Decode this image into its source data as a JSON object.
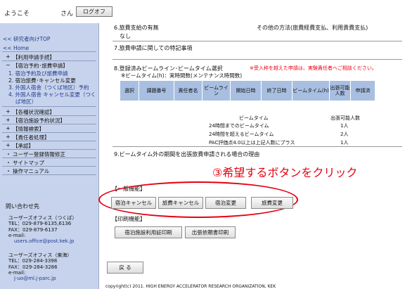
{
  "header": {
    "welcome": "ようこそ",
    "san": "さん",
    "logoff": "ログオフ"
  },
  "sidebar": {
    "top_link": "<< 研究者向けTOP",
    "home_link": "<< Home",
    "items": [
      {
        "mark": "+",
        "label": "【利用申請手続】"
      },
      {
        "mark": "−",
        "label": "【宿泊予約･旅費申請】"
      },
      {
        "mark": "+",
        "label": "【各種状況確認】"
      },
      {
        "mark": "+",
        "label": "【宿泊施設予約状況】"
      },
      {
        "mark": "+",
        "label": "【情報検索】"
      },
      {
        "mark": "+",
        "label": "【責任者処理】"
      },
      {
        "mark": "+",
        "label": "【承認】"
      },
      {
        "mark": "・",
        "label": "ユーザー登録情報修正"
      },
      {
        "mark": "・",
        "label": "サイトマップ"
      },
      {
        "mark": "・",
        "label": "操作マニュアル"
      }
    ],
    "subitems": [
      "1. 宿泊予約及び旅費申請",
      "2. 宿泊旅費･キャンセル変更",
      "3. 外国人宿舎（つくば地区）予約",
      "4. 外国人宿舎 キャンセル変更（つく",
      "ば地区）"
    ],
    "contact": {
      "title": "問い合わせ先",
      "tsukuba": {
        "name": "ユーザーズオフィス（つくば）",
        "tel": "TEL：029-879-6135,6136",
        "fax": "FAX：029-879-6137",
        "email_label": "e-mail:",
        "email": "users.office@post.kek.jp"
      },
      "tokai": {
        "name": "ユーザーズオフィス（東海）",
        "tel": "TEL：029-284-3398",
        "fax": "FAX：029-284-3286",
        "email_label": "e-mail:",
        "email": "j-uo@ml.j-parc.jp"
      }
    }
  },
  "main": {
    "top_cut_left": "6.旅費支給の有無",
    "top_cut_right": "その他の方法(旅費経費支払、利用責費支払)",
    "nashi": "なし",
    "sec7": "7.旅費申請に関しての特記事項",
    "sec8": "8.登録済みビームライン･ビームタイム選択",
    "sec8_note": "※受入枠を越えた申請は、実験責任者へご相談ください。",
    "beamtime_note": "※ビームタイム(h)：実時間数(メンテナンス時間数)",
    "table_headers": [
      "選択",
      "課題番号",
      "責任者名",
      "ビームライン",
      "開始日時",
      "終了日時",
      "ビームタイム(h)",
      "出張可能人数",
      "申請済"
    ],
    "priority": {
      "col1": "ビームタイム",
      "col2": "出張可能人数",
      "rows": [
        {
          "cond": "24時間までのビームタイム",
          "num": "1人"
        },
        {
          "cond": "24時間を超えるビームタイム",
          "num": "2人"
        },
        {
          "cond": "PAC評価点4.0以上は上記人数にプラス",
          "num": "1人"
        }
      ]
    },
    "sec9": "9.ビームタイム外の期間を出張旅費申請される場合の理由",
    "annotation": "③希望するボタンをクリック",
    "general_label": "【一般機能】",
    "general_buttons": [
      "宿泊キャンセル",
      "旅費キャンセル",
      "宿泊変更",
      "旅費変更"
    ],
    "print_label": "【印刷機能】",
    "print_buttons": [
      "宿泊施設利用証印刷",
      "出張依頼書印刷"
    ],
    "back_button": "戻 る",
    "footer": "copyright(c) 2011. HIGH ENERGY ACCELERATOR RESEARCH ORGANIZATION, KEK"
  },
  "colors": {
    "sidebar_bg": "#c7d3ec",
    "table_header_bg": "#a8bfe1",
    "annotation_red": "#e60012",
    "link_blue": "#1f3a8f"
  }
}
